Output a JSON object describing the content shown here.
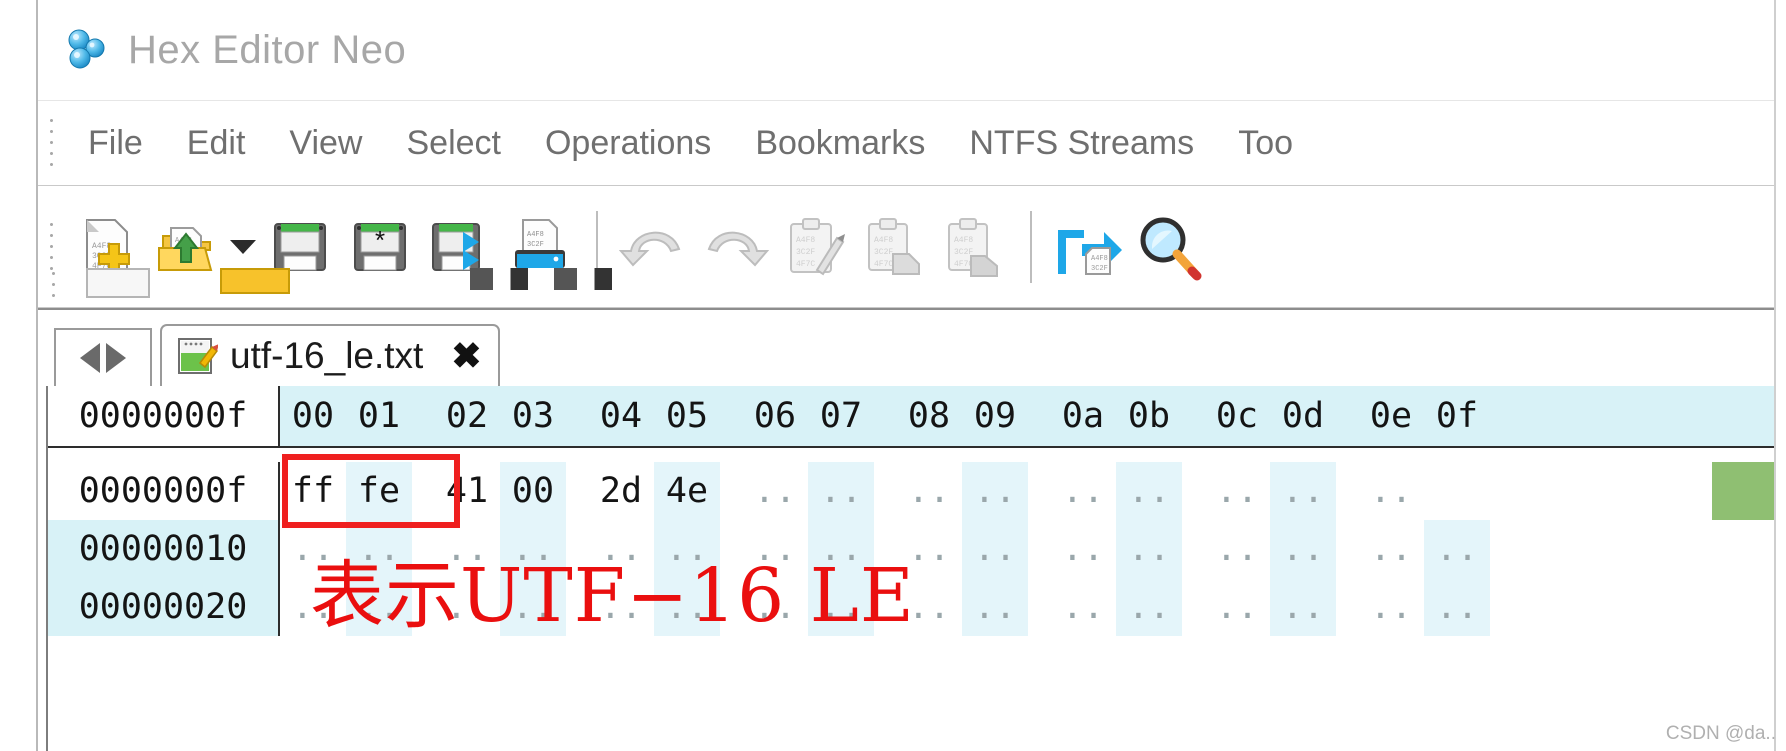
{
  "app": {
    "title": "Hex Editor Neo",
    "logo_icon": "molecule-icon"
  },
  "menu": {
    "items": [
      {
        "label": "File",
        "name": "menu-file"
      },
      {
        "label": "Edit",
        "name": "menu-edit"
      },
      {
        "label": "View",
        "name": "menu-view"
      },
      {
        "label": "Select",
        "name": "menu-select"
      },
      {
        "label": "Operations",
        "name": "menu-operations"
      },
      {
        "label": "Bookmarks",
        "name": "menu-bookmarks"
      },
      {
        "label": "NTFS Streams",
        "name": "menu-ntfs-streams"
      },
      {
        "label": "Too",
        "name": "menu-tools"
      }
    ]
  },
  "toolbar": {
    "buttons": [
      {
        "icon": "new-file-icon",
        "enabled": true
      },
      {
        "icon": "open-file-icon",
        "enabled": true
      },
      {
        "icon": "chevron-down-icon",
        "enabled": true
      },
      {
        "icon": "save-icon",
        "enabled": true
      },
      {
        "icon": "save-as-icon",
        "enabled": true
      },
      {
        "icon": "save-all-icon",
        "enabled": true
      },
      {
        "icon": "print-icon",
        "enabled": true
      },
      {
        "icon": "undo-icon",
        "enabled": false
      },
      {
        "icon": "redo-icon",
        "enabled": false
      },
      {
        "icon": "cut-icon",
        "enabled": false
      },
      {
        "icon": "copy-icon",
        "enabled": false
      },
      {
        "icon": "paste-icon",
        "enabled": false
      },
      {
        "icon": "goto-icon",
        "enabled": true
      },
      {
        "icon": "find-icon",
        "enabled": true
      }
    ]
  },
  "tabs": {
    "nav_prev_icon": "arrow-left-icon",
    "nav_next_icon": "arrow-right-icon",
    "active": {
      "label": "utf-16_le.txt",
      "icon": "text-document-icon",
      "close_label": "✖"
    }
  },
  "hex": {
    "offset_header": "0000000f",
    "columns": [
      "00",
      "01",
      "02",
      "03",
      "04",
      "05",
      "06",
      "07",
      "08",
      "09",
      "0a",
      "0b",
      "0c",
      "0d",
      "0e",
      "0f"
    ],
    "rows": [
      {
        "offset": "0000000f",
        "bytes": [
          "ff",
          "fe",
          "41",
          "00",
          "2d",
          "4e",
          "..",
          "..",
          "..",
          "..",
          "..",
          "..",
          "..",
          "..",
          "..",
          ".."
        ],
        "highlight_start": 0,
        "highlight_len": 2
      },
      {
        "offset": "00000010",
        "bytes": [
          "..",
          "..",
          "..",
          "..",
          "..",
          "..",
          "..",
          "..",
          "..",
          "..",
          "..",
          "..",
          "..",
          "..",
          "..",
          ".."
        ],
        "highlight_start": -1,
        "highlight_len": 0
      },
      {
        "offset": "00000020",
        "bytes": [
          "..",
          "..",
          "..",
          "..",
          "..",
          "..",
          "..",
          "..",
          "..",
          "..",
          "..",
          "..",
          "..",
          "..",
          "..",
          ".."
        ],
        "highlight_start": -1,
        "highlight_len": 0
      }
    ]
  },
  "annotation": {
    "text": "表示UTF−16 LE",
    "color": "#ea0f0f"
  },
  "watermark": {
    "text": "CSDN @da.."
  },
  "colors": {
    "header_bg": "#d8f2f7",
    "column_shade": "#e4f5fa",
    "highlight_red": "#ef1f1f",
    "selected_green": "#8fbf72",
    "title_gray": "#a7a7a7",
    "menu_gray": "#6f6f6f"
  }
}
